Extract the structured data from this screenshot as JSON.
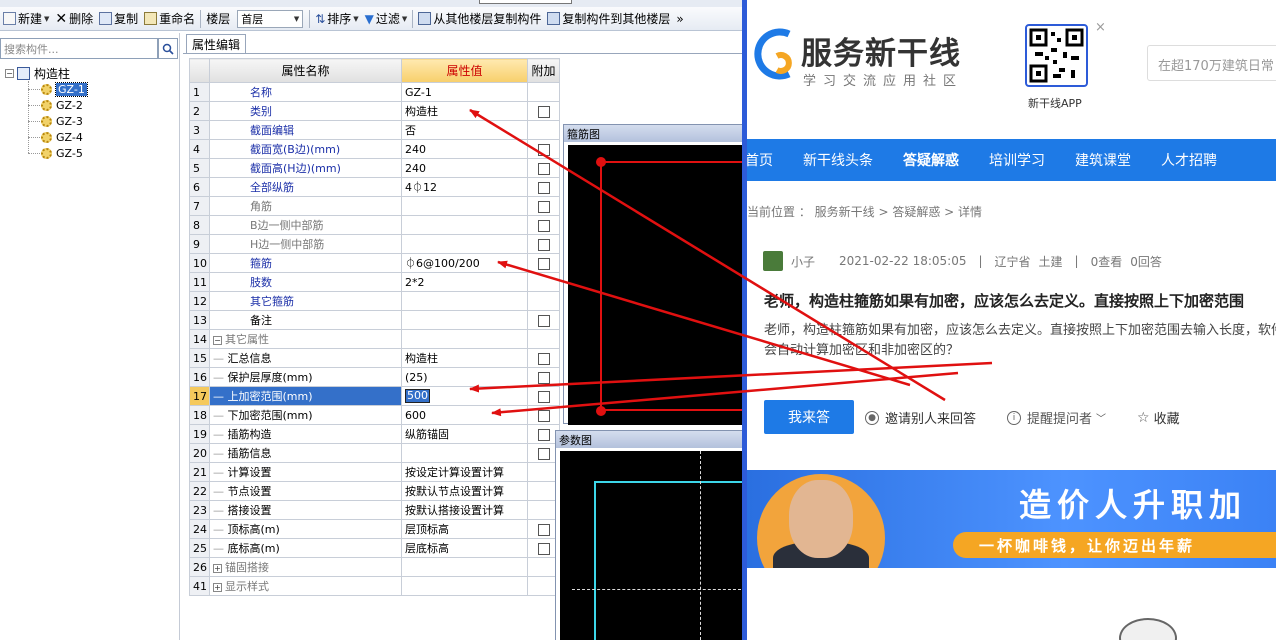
{
  "toolbar": {
    "new": "新建",
    "delete": "删除",
    "copy": "复制",
    "rename": "重命名",
    "floor_label": "楼层",
    "floor_value": "首层",
    "sort": "排序",
    "filter": "过滤",
    "copy_from": "从其他楼层复制构件",
    "copy_to": "复制构件到其他楼层",
    "more": "»"
  },
  "tree": {
    "search_placeholder": "搜索构件...",
    "root": "构造柱",
    "items": [
      "GZ-1",
      "GZ-2",
      "GZ-3",
      "GZ-4",
      "GZ-5"
    ],
    "selected": "GZ-1"
  },
  "props": {
    "tab": "属性编辑",
    "headers": {
      "name": "属性名称",
      "value": "属性值",
      "extra": "附加"
    },
    "rows": [
      {
        "n": "1",
        "name": "名称",
        "value": "GZ-1"
      },
      {
        "n": "2",
        "name": "类别",
        "value": "构造柱"
      },
      {
        "n": "3",
        "name": "截面编辑",
        "value": "否"
      },
      {
        "n": "4",
        "name": "截面宽(B边)(mm)",
        "value": "240"
      },
      {
        "n": "5",
        "name": "截面高(H边)(mm)",
        "value": "240"
      },
      {
        "n": "6",
        "name": "全部纵筋",
        "value": "4⏀12"
      },
      {
        "n": "7",
        "name": "角筋",
        "value": ""
      },
      {
        "n": "8",
        "name": "B边一侧中部筋",
        "value": ""
      },
      {
        "n": "9",
        "name": "H边一侧中部筋",
        "value": ""
      },
      {
        "n": "10",
        "name": "箍筋",
        "value": "⏀6@100/200"
      },
      {
        "n": "11",
        "name": "肢数",
        "value": "2*2"
      },
      {
        "n": "12",
        "name": "其它箍筋",
        "value": ""
      },
      {
        "n": "13",
        "name": "备注",
        "value": ""
      },
      {
        "n": "14",
        "name": "其它属性",
        "value": ""
      },
      {
        "n": "15",
        "name": "汇总信息",
        "value": "构造柱"
      },
      {
        "n": "16",
        "name": "保护层厚度(mm)",
        "value": "(25)"
      },
      {
        "n": "17",
        "name": "上加密范围(mm)",
        "value": "500"
      },
      {
        "n": "18",
        "name": "下加密范围(mm)",
        "value": "600"
      },
      {
        "n": "19",
        "name": "插筋构造",
        "value": "纵筋锚固"
      },
      {
        "n": "20",
        "name": "插筋信息",
        "value": ""
      },
      {
        "n": "21",
        "name": "计算设置",
        "value": "按设定计算设置计算"
      },
      {
        "n": "22",
        "name": "节点设置",
        "value": "按默认节点设置计算"
      },
      {
        "n": "23",
        "name": "搭接设置",
        "value": "按默认搭接设置计算"
      },
      {
        "n": "24",
        "name": "顶标高(m)",
        "value": "层顶标高"
      },
      {
        "n": "25",
        "name": "底标高(m)",
        "value": "层底标高"
      },
      {
        "n": "26",
        "name": "锚固搭接",
        "value": ""
      },
      {
        "n": "41",
        "name": "显示样式",
        "value": ""
      }
    ]
  },
  "previews": {
    "stirrup_title": "箍筋图",
    "param_title": "参数图"
  },
  "site": {
    "logo": "服务新干线",
    "logo_sub": "学习交流应用社区",
    "app_label": "新干线APP",
    "qr_close": "×",
    "search_placeholder": "在超170万建筑日常",
    "nav": [
      "首页",
      "新干线头条",
      "答疑解惑",
      "培训学习",
      "建筑课堂",
      "人才招聘"
    ],
    "nav_active": "答疑解惑",
    "crumb": "当前位置 ： 服务新干线 > 答疑解惑 > 详情",
    "user": "小子",
    "time": "2021-02-22 18:05:05",
    "region": "辽宁省",
    "tag": "土建",
    "views": "0查看",
    "answers": "0回答",
    "sep": "|",
    "title": "老师，构造柱箍筋如果有加密，应该怎么去定义。直接按照上下加密范围",
    "body": "老师，构造柱箍筋如果有加密，应该怎么去定义。直接按照上下加密范围去输入长度，软件会自动计算加密区和非加密区的？",
    "answer_btn": "我来答",
    "invite": "邀请别人来回答",
    "remind": "提醒提问者",
    "collect": "收藏",
    "banner_title": "造价人升职加",
    "banner_sub": "一杯咖啡钱，让你迈出年薪",
    "colors": {
      "nav": "#1e7ae6",
      "divider": "#2d5bd8",
      "arrow": "#e01010",
      "banner_sub": "#f5a623"
    }
  }
}
